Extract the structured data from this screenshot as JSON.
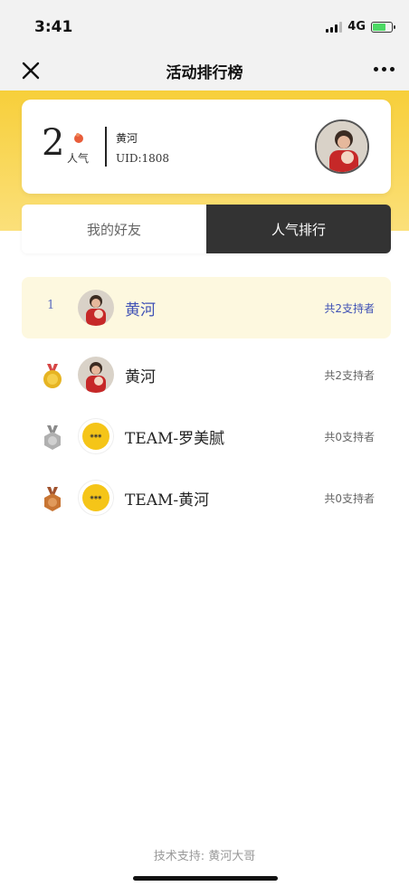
{
  "status_bar": {
    "time": "3:41",
    "network": "4G"
  },
  "nav": {
    "title": "活动排行榜",
    "close_icon": "close-icon",
    "more_icon": "more-icon"
  },
  "profile_card": {
    "rank": "2",
    "popularity_label": "人气",
    "name": "黄河",
    "uid": "UID:1808"
  },
  "tabs": {
    "friends": "我的好友",
    "popularity": "人气排行"
  },
  "ranking": [
    {
      "rank": "1",
      "name": "黄河",
      "supporters": "共2支持者",
      "is_self": true,
      "avatar": "person"
    },
    {
      "rank": "1",
      "name": "黄河",
      "supporters": "共2支持者",
      "medal": "gold",
      "avatar": "person"
    },
    {
      "rank": "2",
      "name": "TEAM-罗美腻",
      "supporters": "共0支持者",
      "medal": "silver",
      "avatar": "team"
    },
    {
      "rank": "3",
      "name": "TEAM-黄河",
      "supporters": "共0支持者",
      "medal": "bronze",
      "avatar": "team"
    }
  ],
  "footer": {
    "text": "技术支持: 黄河大哥"
  },
  "colors": {
    "accent_yellow": "#f7cf3a",
    "highlight_row": "#fdf8df",
    "self_blue": "#3f51b5",
    "gold": "#e6b422",
    "silver": "#b0b0b0",
    "bronze": "#c87533"
  }
}
